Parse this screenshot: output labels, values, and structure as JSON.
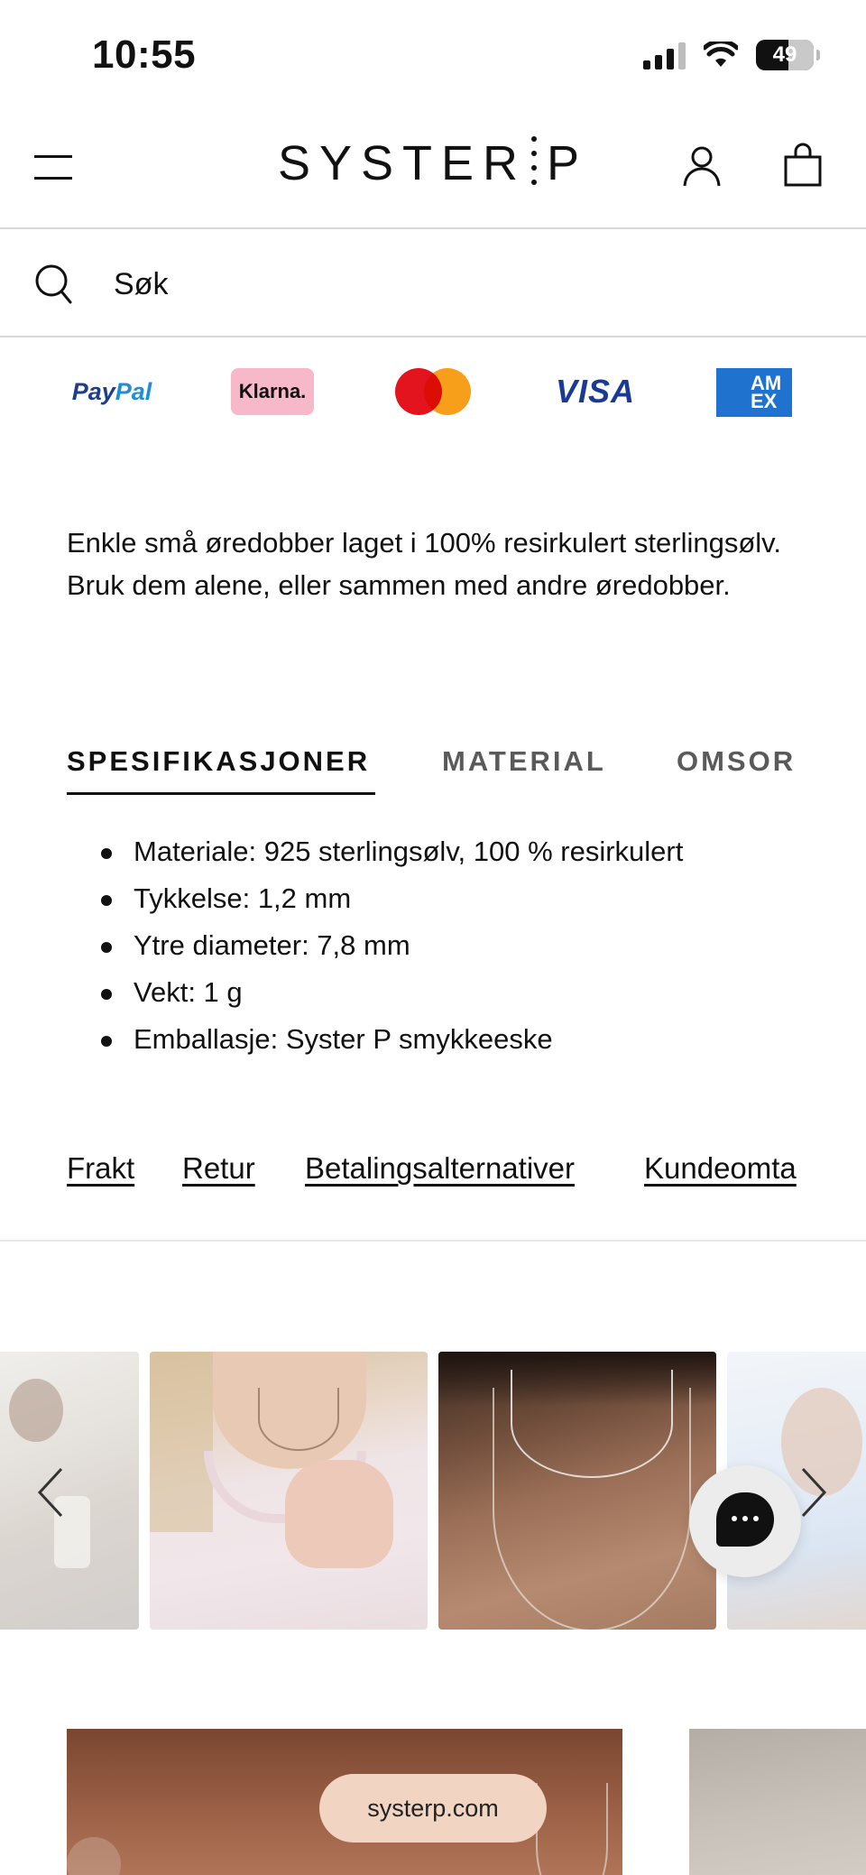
{
  "status_bar": {
    "time": "10:55",
    "battery": "49",
    "battery_level": 0.49
  },
  "header": {
    "logo_left": "SYSTER",
    "logo_right": "P"
  },
  "search": {
    "placeholder": "Søk"
  },
  "payment_methods": {
    "paypal_a": "Pay",
    "paypal_b": "Pal",
    "klarna": "Klarna.",
    "visa": "VISA",
    "amex_a": "AM",
    "amex_b": "EX"
  },
  "product": {
    "description": "Enkle små øredobber laget i 100% resirkulert sterlingsølv. Bruk dem alene, eller sammen med andre øredobber."
  },
  "tabs": [
    {
      "label": "SPESIFIKASJONER",
      "active": true
    },
    {
      "label": "MATERIAL",
      "active": false
    },
    {
      "label": "OMSOR",
      "active": false
    }
  ],
  "specs": [
    "Materiale: 925 sterlingsølv, 100 % resirkulert",
    "Tykkelse: 1,2 mm",
    "Ytre diameter: 7,8 mm",
    "Vekt: 1 g",
    "Emballasje: Syster P smykkeeske"
  ],
  "info_links": [
    "Frakt",
    "Retur",
    "Betalingsalternativer",
    "Kundeomta"
  ],
  "promo": {
    "url": "systerp.com"
  },
  "colors": {
    "text": "#111111",
    "inactive_tab": "#5a5a5a",
    "klarna_pink": "#f7b8c9",
    "amex_blue": "#1f72cd",
    "visa_blue": "#1a3a93",
    "pill": "#f2d4c2"
  },
  "icons": [
    "signal-icon",
    "wifi-icon",
    "battery-icon",
    "menu-icon",
    "account-icon",
    "cart-icon",
    "search-icon",
    "chevron-left-icon",
    "chevron-right-icon",
    "chat-icon"
  ]
}
